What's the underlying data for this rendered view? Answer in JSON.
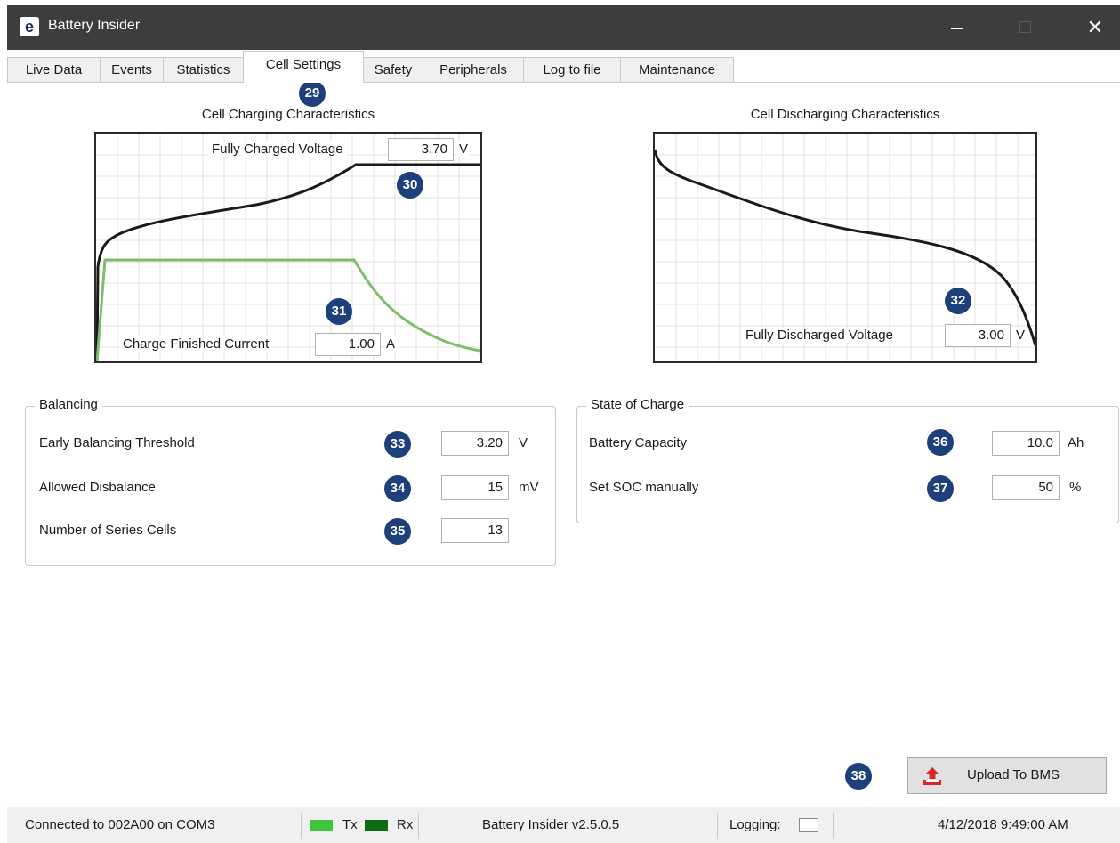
{
  "window": {
    "title": "Battery Insider",
    "app_icon_glyph": "e",
    "min_glyph": "",
    "close_glyph": "✕"
  },
  "tabs": [
    {
      "label": "Live Data"
    },
    {
      "label": "Events"
    },
    {
      "label": "Statistics"
    },
    {
      "label": "Cell Settings",
      "active": true
    },
    {
      "label": "Safety"
    },
    {
      "label": "Peripherals"
    },
    {
      "label": "Log to file"
    },
    {
      "label": "Maintenance"
    }
  ],
  "markers": [
    "29",
    "30",
    "31",
    "32",
    "33",
    "34",
    "35",
    "36",
    "37",
    "38"
  ],
  "charging": {
    "title": "Cell Charging Characteristics",
    "full_voltage_label": "Fully Charged Voltage",
    "full_voltage_value": "3.70",
    "full_voltage_unit": "V",
    "finish_current_label": "Charge Finished Current",
    "finish_current_value": "1.00",
    "finish_current_unit": "A",
    "voltage_color": "#1a1a1a",
    "current_color": "#7cbf6a"
  },
  "discharging": {
    "title": "Cell Discharging Characteristics",
    "empty_voltage_label": "Fully Discharged Voltage",
    "empty_voltage_value": "3.00",
    "empty_voltage_unit": "V"
  },
  "balancing": {
    "legend": "Balancing",
    "rows": [
      {
        "label": "Early Balancing Threshold",
        "value": "3.20",
        "unit": "V"
      },
      {
        "label": "Allowed Disbalance",
        "value": "15",
        "unit": "mV"
      },
      {
        "label": "Number of Series Cells",
        "value": "13",
        "unit": ""
      }
    ]
  },
  "soc": {
    "legend": "State of Charge",
    "rows": [
      {
        "label": "Battery Capacity",
        "value": "10.0",
        "unit": "Ah"
      },
      {
        "label": "Set SOC manually",
        "value": "50",
        "unit": "%"
      }
    ]
  },
  "upload": {
    "label": "Upload To BMS",
    "icon": "upload-icon",
    "icon_color": "#d42a2a"
  },
  "status": {
    "connection": "Connected to 002A00 on COM3",
    "tx_label": "Tx",
    "rx_label": "Rx",
    "tx_color": "#3ec43e",
    "rx_color": "#0f6b12",
    "version": "Battery Insider v2.5.0.5",
    "logging_label": "Logging:",
    "datetime": "4/12/2018 9:49:00 AM"
  }
}
